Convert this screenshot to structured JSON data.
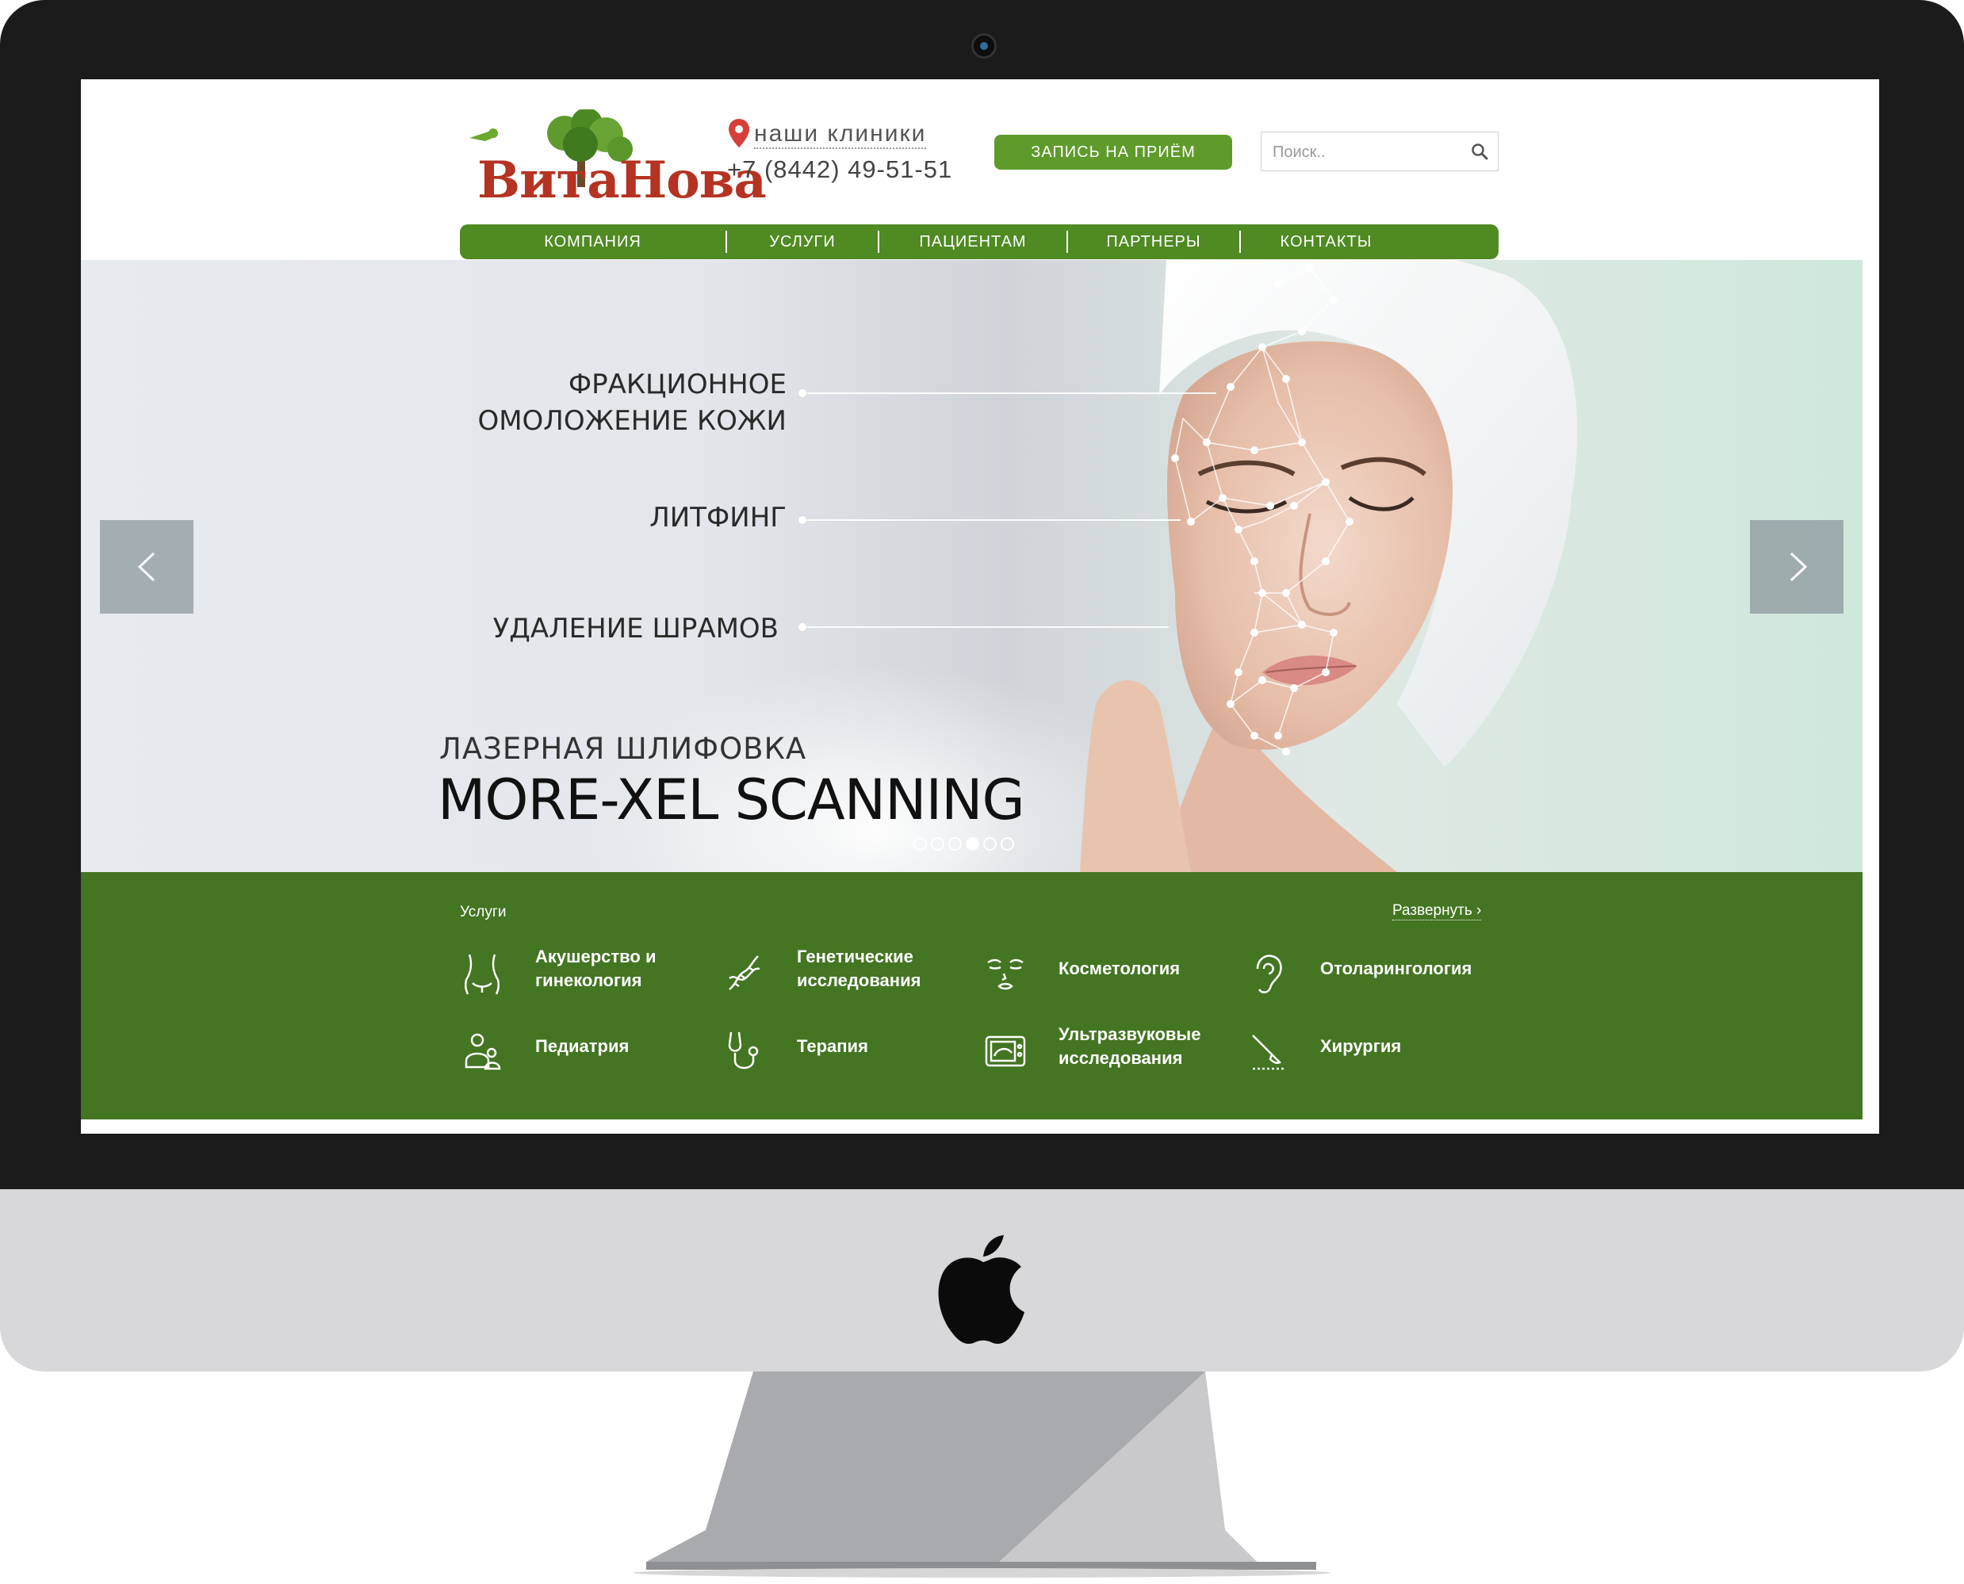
{
  "header": {
    "logo_part1": "Вита",
    "logo_part2": "Нова",
    "clinics_link": "наши клиники",
    "phone": "+7 (8442) 49-51-51",
    "book_button": "ЗАПИСЬ НА ПРИЁМ",
    "search_placeholder": "Поиск.."
  },
  "nav": {
    "items": [
      "КОМПАНИЯ",
      "УСЛУГИ",
      "ПАЦИЕНТАМ",
      "ПАРТНЕРЫ",
      "КОНТАКТЫ"
    ]
  },
  "hero": {
    "bullet1_line1": "ФРАКЦИОННОЕ",
    "bullet1_line2": "ОМОЛОЖЕНИЕ КОЖИ",
    "bullet2": "ЛИТФИНГ",
    "bullet3": "УДАЛЕНИЕ ШРАМОВ",
    "subtitle": "ЛАЗЕРНАЯ ШЛИФОВКА",
    "title": "MORE-XEL SCANNING",
    "slides_total": 6,
    "active_slide": 4
  },
  "services": {
    "heading": "Услуги",
    "expand_link": "Развернуть",
    "items": [
      {
        "icon": "body-icon",
        "line1": "Акушерство и",
        "line2": "гинекология"
      },
      {
        "icon": "dna-icon",
        "line1": "Генетические",
        "line2": "исследования"
      },
      {
        "icon": "face-icon",
        "line1": "Косметология",
        "line2": ""
      },
      {
        "icon": "ear-icon",
        "line1": "Отоларингология",
        "line2": ""
      },
      {
        "icon": "family-icon",
        "line1": "Педиатрия",
        "line2": ""
      },
      {
        "icon": "stethoscope-icon",
        "line1": "Терапия",
        "line2": ""
      },
      {
        "icon": "ultrasound-icon",
        "line1": "Ультразвуковые",
        "line2": "исследования"
      },
      {
        "icon": "scalpel-icon",
        "line1": "Хирургия",
        "line2": ""
      }
    ]
  },
  "colors": {
    "brand_green": "#5e9b2b",
    "nav_green": "#4f8a22",
    "services_green": "#447522",
    "logo_red": "#b53322"
  }
}
